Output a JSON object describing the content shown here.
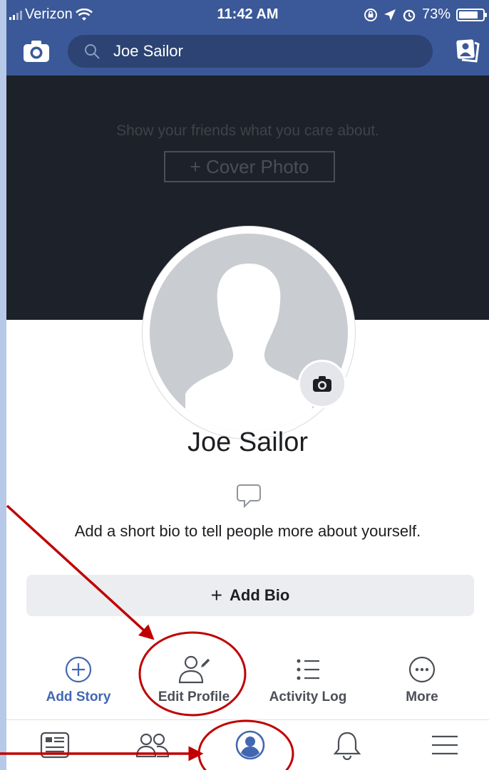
{
  "status": {
    "carrier": "Verizon",
    "time": "11:42 AM",
    "battery": "73%",
    "battery_level": 0.73
  },
  "header": {
    "search_value": "Joe Sailor"
  },
  "cover": {
    "prompt": "Show your friends what you care about.",
    "button_label": "+ Cover Photo"
  },
  "profile": {
    "name": "Joe Sailor",
    "bio_prompt": "Add a short bio to tell people more about yourself.",
    "add_bio_label": "Add Bio",
    "add_bio_plus": "+"
  },
  "actions": [
    {
      "label": "Add Story",
      "icon": "add-circle-icon",
      "active": true
    },
    {
      "label": "Edit Profile",
      "icon": "edit-profile-icon",
      "active": false
    },
    {
      "label": "Activity Log",
      "icon": "list-icon",
      "active": false
    },
    {
      "label": "More",
      "icon": "more-icon",
      "active": false
    }
  ],
  "tabs": [
    {
      "icon": "news-feed-icon",
      "active": false
    },
    {
      "icon": "friends-icon",
      "active": false
    },
    {
      "icon": "profile-icon",
      "active": true
    },
    {
      "icon": "bell-icon",
      "active": false
    },
    {
      "icon": "menu-icon",
      "active": false
    }
  ],
  "colors": {
    "brand": "#3b5998",
    "accent": "#4267b2",
    "annotation": "#c00000",
    "cover": "#1d2129"
  }
}
